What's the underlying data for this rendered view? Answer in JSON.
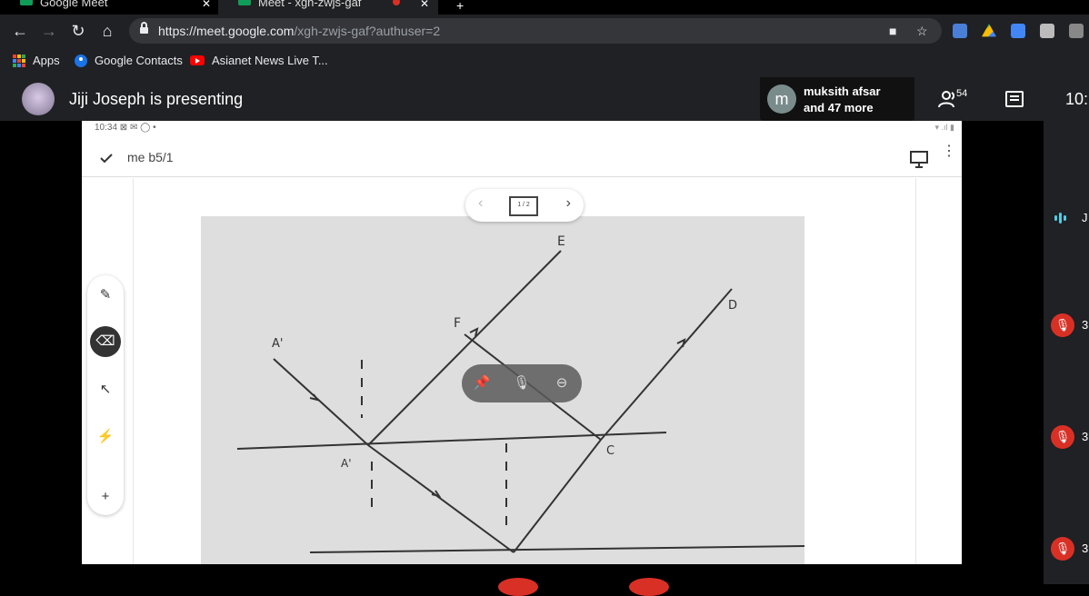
{
  "browser": {
    "tabs": [
      {
        "title": "Google Meet",
        "active": false
      },
      {
        "title": "Meet - xgh-zwjs-gaf",
        "active": true
      }
    ],
    "url_host": "https://meet.google.com",
    "url_path": "/xgh-zwjs-gaf?authuser=2",
    "bookmarks": [
      {
        "label": "Apps",
        "icon": "apps-grid-icon"
      },
      {
        "label": "Google Contacts",
        "icon": "contacts-icon"
      },
      {
        "label": "Asianet News Live T...",
        "icon": "youtube-icon"
      }
    ]
  },
  "meet": {
    "presenting_title": "Jiji Joseph is presenting",
    "participant_chip": {
      "initial": "m",
      "line1": "muksith afsar",
      "line2": "and 47 more"
    },
    "people_count": "54",
    "clock": "10:",
    "rail": [
      {
        "label": "J",
        "state": "speaking"
      },
      {
        "label": "3",
        "state": "muted"
      },
      {
        "label": "3",
        "state": "muted"
      },
      {
        "label": "3",
        "state": "muted"
      }
    ]
  },
  "screen": {
    "status_time": "10:34",
    "doc_title": "me b5/1",
    "page_indicator": "1 / 2",
    "diagram_labels": [
      "E",
      "D",
      "F",
      "A'",
      "A'",
      "C"
    ]
  },
  "colors": {
    "accent_red": "#d93025",
    "speaking": "#4ecde6",
    "chrome_dark": "#202124"
  }
}
